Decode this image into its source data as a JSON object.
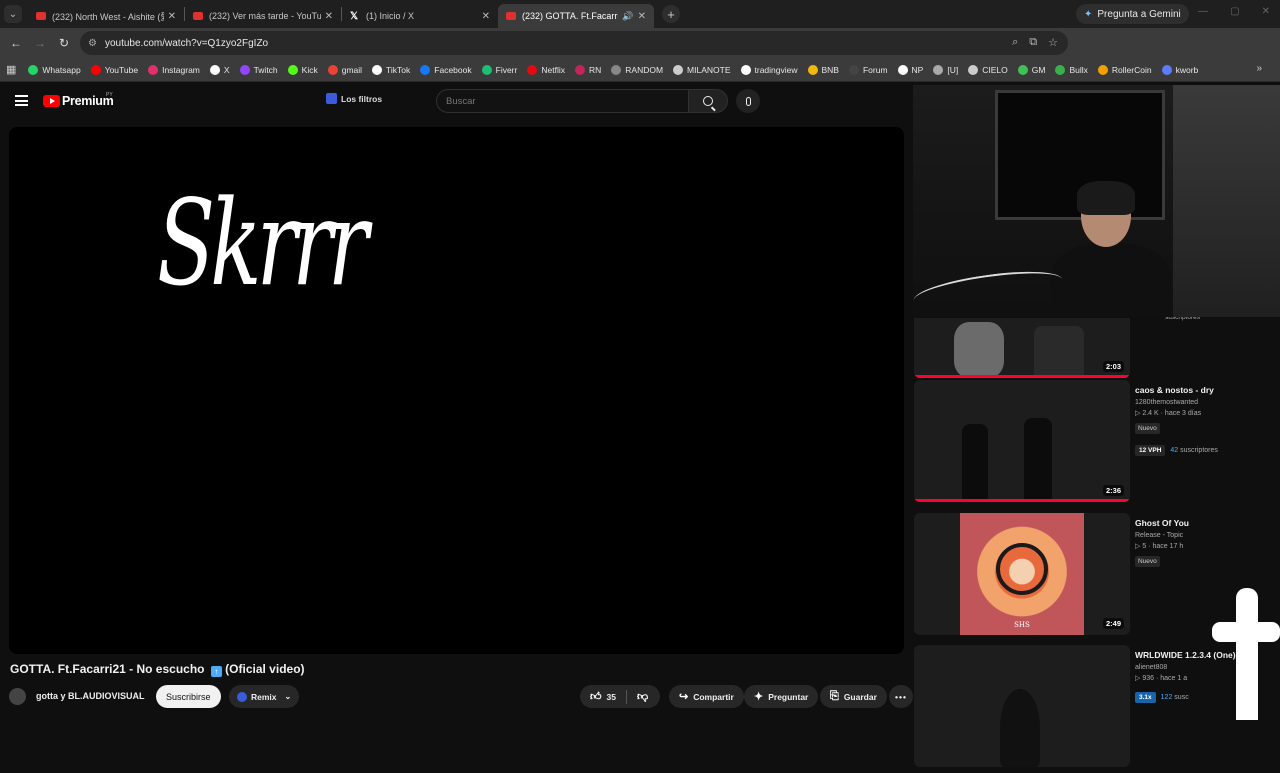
{
  "browser": {
    "tabs": [
      {
        "title": "(232) North West - Aishite (愛し",
        "icon": "youtube-icon",
        "active": false
      },
      {
        "title": "(232) Ver más tarde - YouTube",
        "icon": "youtube-icon",
        "active": false
      },
      {
        "title": "(1) Inicio / X",
        "icon": "x-icon",
        "active": false
      },
      {
        "title": "(232) GOTTA. Ft.Facarri21 -",
        "icon": "youtube-icon",
        "active": true
      }
    ],
    "gemini_label": "Pregunta a Gemini",
    "url": "youtube.com/watch?v=Q1zyo2FgIZo",
    "bookmarks": [
      {
        "label": "Whatsapp",
        "color": "#25d366"
      },
      {
        "label": "YouTube",
        "color": "#ff0000"
      },
      {
        "label": "Instagram",
        "color": "#e1306c"
      },
      {
        "label": "X",
        "color": "#ffffff"
      },
      {
        "label": "Twitch",
        "color": "#9146ff"
      },
      {
        "label": "Kick",
        "color": "#53fc18"
      },
      {
        "label": "gmail",
        "color": "#ea4335"
      },
      {
        "label": "TikTok",
        "color": "#ffffff"
      },
      {
        "label": "Facebook",
        "color": "#1877f2"
      },
      {
        "label": "Fiverr",
        "color": "#1dbf73"
      },
      {
        "label": "Netflix",
        "color": "#e50914"
      },
      {
        "label": "RN",
        "color": "#c2255c"
      },
      {
        "label": "RANDOM",
        "color": "#888888"
      },
      {
        "label": "MILANOTE",
        "color": "#cccccc"
      },
      {
        "label": "tradingview",
        "color": "#ffffff"
      },
      {
        "label": "BNB",
        "color": "#f0b90b"
      },
      {
        "label": "Forum",
        "color": "#444444"
      },
      {
        "label": "NP",
        "color": "#ffffff"
      },
      {
        "label": "[U]",
        "color": "#aaaaaa"
      },
      {
        "label": "CIELO",
        "color": "#cccccc"
      },
      {
        "label": "GM",
        "color": "#40c057"
      },
      {
        "label": "Bullx",
        "color": "#37b24d"
      },
      {
        "label": "RollerCoin",
        "color": "#f59f00"
      },
      {
        "label": "kworb",
        "color": "#5c7cfa"
      }
    ]
  },
  "youtube": {
    "logo_text": "Premium",
    "logo_sup": "PY",
    "filtros_label": "Los filtros",
    "search_placeholder": "Buscar",
    "video": {
      "overlay_text": "Skrrr",
      "title": "GOTTA. Ft.Facarri21 - No escucho",
      "title_suffix": "(Oficial video)",
      "channel": "gotta y BL.AUDIOVISUAL",
      "subscribe_label": "Suscribirse",
      "remix_label": "Remix",
      "likes": "35",
      "share_label": "Compartir",
      "ask_label": "Preguntar",
      "save_label": "Guardar"
    },
    "recommendations": [
      {
        "duration": "2:03",
        "subs_partial": "suscriptores"
      },
      {
        "title": "caos & nostos - dry",
        "channel": "1280themostwanted",
        "views": "2.4 K",
        "age": "hace 3 días",
        "badge": "Nuevo",
        "vph": "12 VPH",
        "subs_num": "42",
        "subs_label": "suscriptores",
        "duration": "2:36"
      },
      {
        "title": "Ghost Of You",
        "channel": "Release - Topic",
        "views": "5",
        "age": "hace 17 h",
        "badge": "Nuevo",
        "duration": "2:49",
        "art_label": "SHS"
      },
      {
        "title": "WRLDWIDE 1.2.3.4 (One)",
        "channel": "alienet808",
        "views": "936",
        "age": "hace 1 a",
        "vph": "3.1x",
        "subs_num": "122",
        "subs_label": "susc"
      }
    ]
  }
}
